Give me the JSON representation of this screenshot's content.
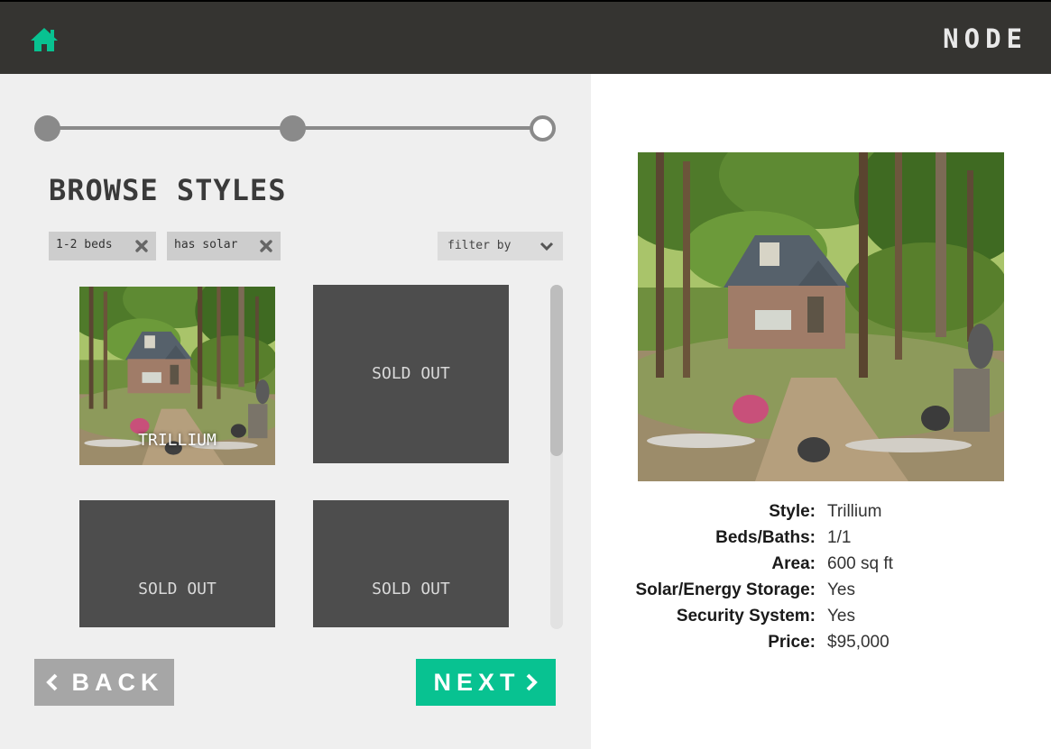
{
  "header": {
    "brand": "NODE",
    "home_icon": "home-icon"
  },
  "colors": {
    "accent": "#08c291",
    "header_bg": "#353431",
    "tile_bg": "#4d4d4d",
    "back_button": "#a6a6a6"
  },
  "progress": {
    "total_steps": 3,
    "completed_steps": 2,
    "current_step": 3
  },
  "browse": {
    "title": "BROWSE STYLES",
    "chips": [
      {
        "label": "1-2 beds"
      },
      {
        "label": "has solar"
      }
    ],
    "filter_label": "filter by",
    "tiles": [
      {
        "label": "TRILLIUM",
        "has_photo": true
      },
      {
        "label": "SOLD OUT",
        "has_photo": false
      },
      {
        "label": "SOLD OUT",
        "has_photo": false
      },
      {
        "label": "SOLD OUT",
        "has_photo": false
      }
    ]
  },
  "nav": {
    "back_label": "BACK",
    "next_label": "NEXT"
  },
  "details": [
    {
      "label": "Style:",
      "value": "Trillium"
    },
    {
      "label": "Beds/Baths:",
      "value": "1/1"
    },
    {
      "label": "Area:",
      "value": "600 sq ft"
    },
    {
      "label": "Solar/Energy Storage:",
      "value": "Yes"
    },
    {
      "label": "Security System:",
      "value": "Yes"
    },
    {
      "label": "Price:",
      "value": "$95,000"
    }
  ]
}
